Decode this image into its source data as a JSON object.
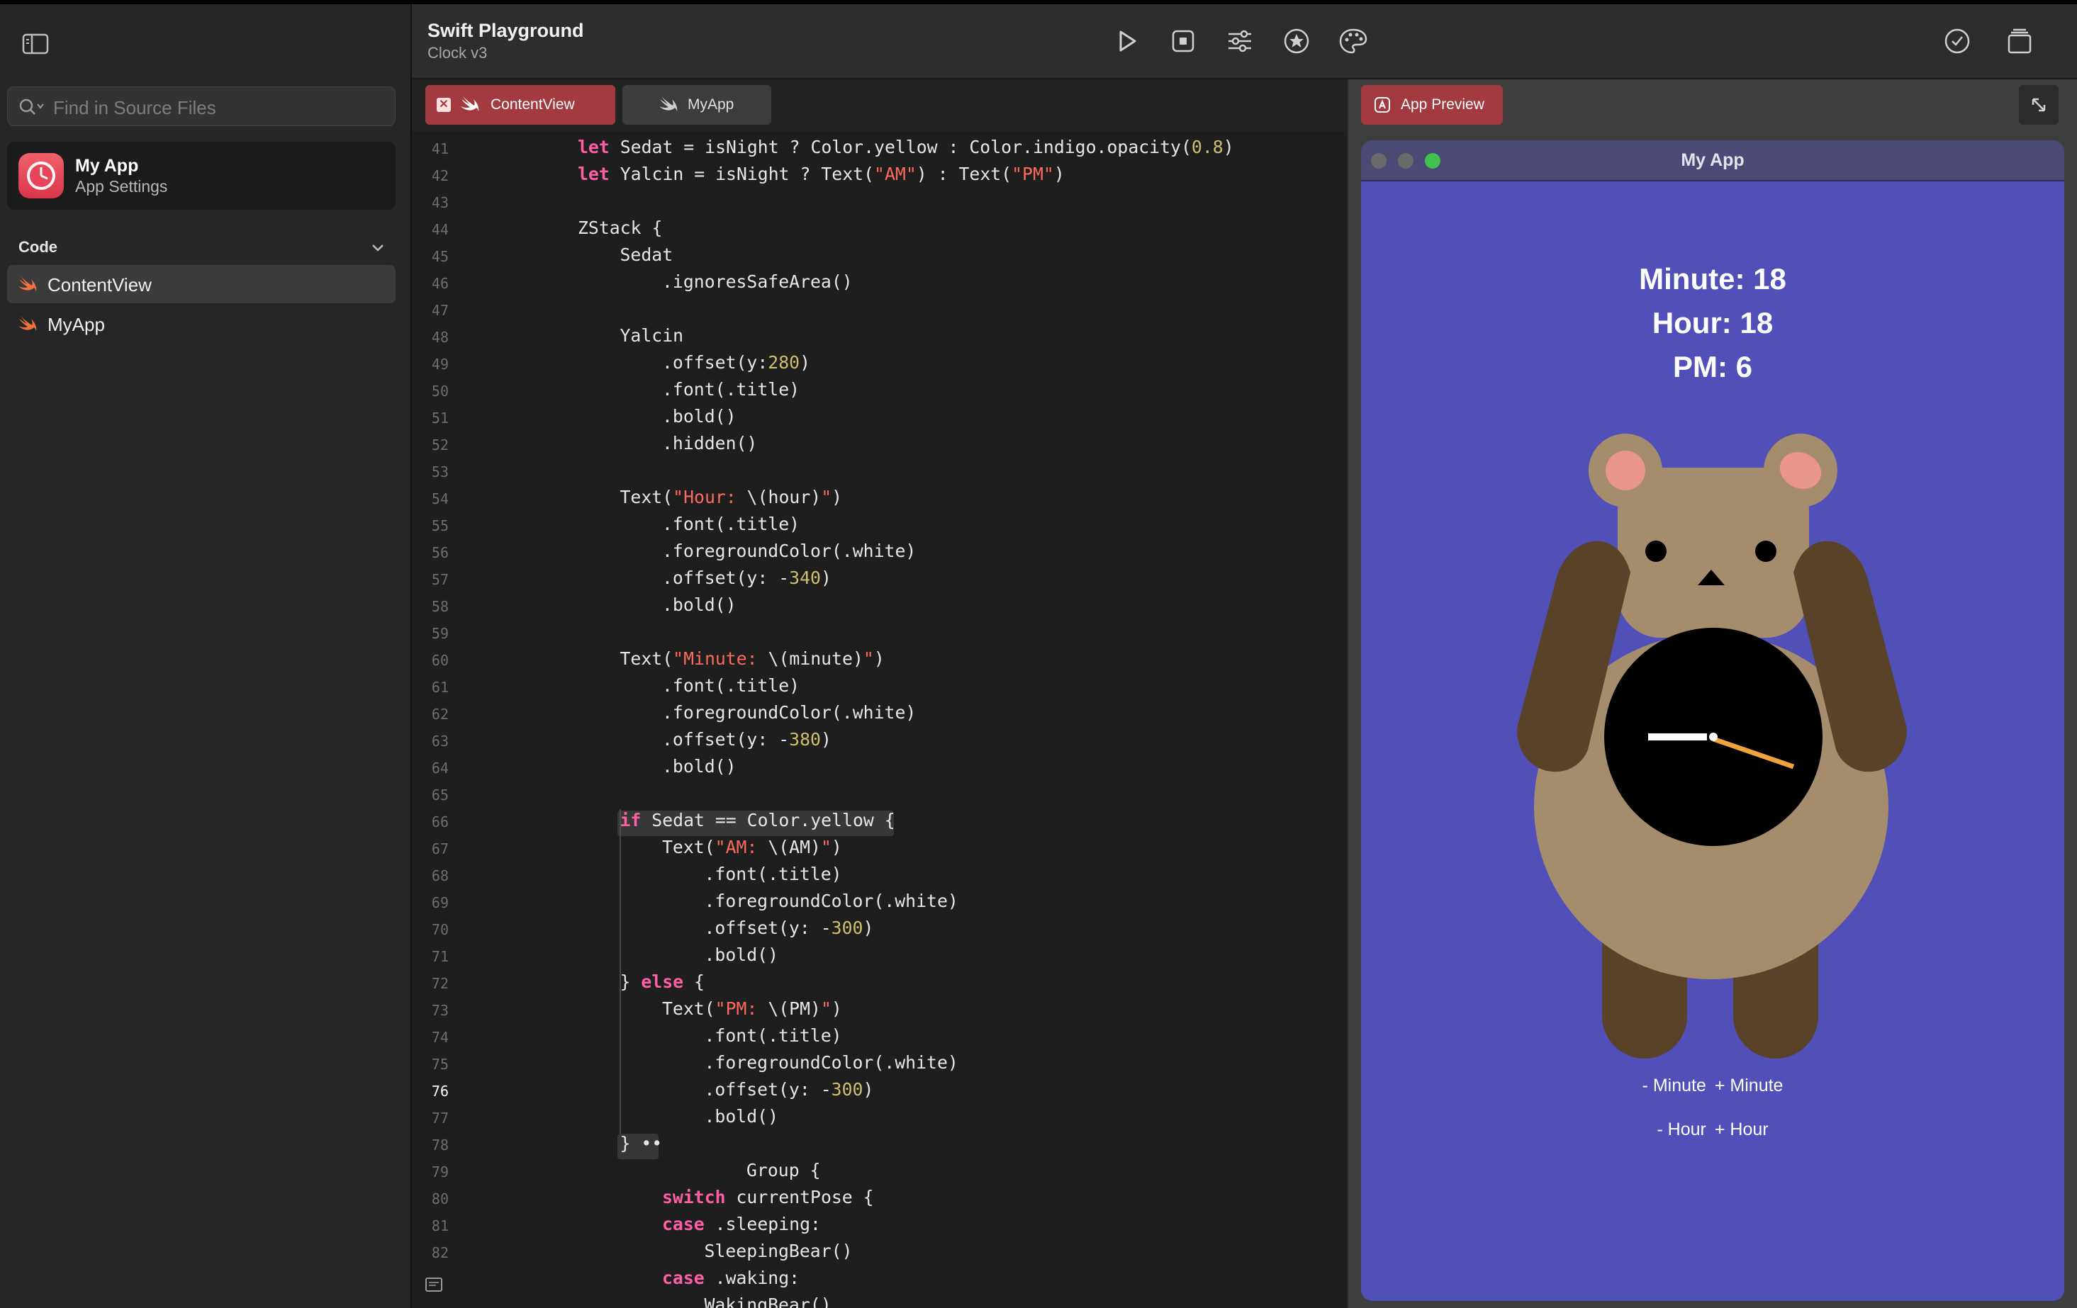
{
  "sidebar": {
    "search_placeholder": "Find in Source Files",
    "app": {
      "name": "My App",
      "subtitle": "App Settings"
    },
    "section": "Code",
    "items": [
      {
        "label": "ContentView",
        "selected": true
      },
      {
        "label": "MyApp",
        "selected": false
      }
    ]
  },
  "toolbar": {
    "title": "Swift Playground",
    "subtitle": "Clock v3",
    "buttons": [
      "play-icon",
      "stop-icon",
      "sliders-icon",
      "star-icon",
      "palette-icon",
      "checkmark-icon",
      "windows-icon"
    ]
  },
  "tabs": [
    {
      "label": "ContentView",
      "active": true
    },
    {
      "label": "MyApp",
      "active": false
    }
  ],
  "editor": {
    "current_line": 76,
    "lines": [
      {
        "n": "41",
        "indent": 2,
        "seg": [
          [
            "kw",
            "let"
          ],
          [
            "p",
            " Sedat = isNight ? Color.yellow : Color.indigo.opacity("
          ],
          [
            "num",
            "0.8"
          ],
          [
            "p",
            ")"
          ]
        ]
      },
      {
        "n": "42",
        "indent": 2,
        "seg": [
          [
            "kw",
            "let"
          ],
          [
            "p",
            " Yalcin = isNight ? Text("
          ],
          [
            "str",
            "\"AM\""
          ],
          [
            "p",
            ") : Text("
          ],
          [
            "str",
            "\"PM\""
          ],
          [
            "p",
            ")"
          ]
        ]
      },
      {
        "n": "43",
        "indent": 0,
        "seg": []
      },
      {
        "n": "44",
        "indent": 2,
        "seg": [
          [
            "p",
            "ZStack {"
          ]
        ]
      },
      {
        "n": "45",
        "indent": 3,
        "seg": [
          [
            "p",
            "Sedat"
          ]
        ]
      },
      {
        "n": "46",
        "indent": 4,
        "seg": [
          [
            "p",
            ".ignoresSafeArea()"
          ]
        ]
      },
      {
        "n": "47",
        "indent": 0,
        "seg": []
      },
      {
        "n": "48",
        "indent": 3,
        "seg": [
          [
            "p",
            "Yalcin"
          ]
        ]
      },
      {
        "n": "49",
        "indent": 4,
        "seg": [
          [
            "p",
            ".offset(y:"
          ],
          [
            "num",
            "280"
          ],
          [
            "p",
            ")"
          ]
        ]
      },
      {
        "n": "50",
        "indent": 4,
        "seg": [
          [
            "p",
            ".font(.title)"
          ]
        ]
      },
      {
        "n": "51",
        "indent": 4,
        "seg": [
          [
            "p",
            ".bold()"
          ]
        ]
      },
      {
        "n": "52",
        "indent": 4,
        "seg": [
          [
            "p",
            ".hidden()"
          ]
        ]
      },
      {
        "n": "53",
        "indent": 0,
        "seg": []
      },
      {
        "n": "54",
        "indent": 3,
        "seg": [
          [
            "p",
            "Text("
          ],
          [
            "str",
            "\"Hour: "
          ],
          [
            "p",
            "\\(hour)"
          ],
          [
            "str",
            "\""
          ],
          [
            "p",
            ")"
          ]
        ]
      },
      {
        "n": "55",
        "indent": 4,
        "seg": [
          [
            "p",
            ".font(.title)"
          ]
        ]
      },
      {
        "n": "56",
        "indent": 4,
        "seg": [
          [
            "p",
            ".foregroundColor(.white)"
          ]
        ]
      },
      {
        "n": "57",
        "indent": 4,
        "seg": [
          [
            "p",
            ".offset(y: -"
          ],
          [
            "num",
            "340"
          ],
          [
            "p",
            ")"
          ]
        ]
      },
      {
        "n": "58",
        "indent": 4,
        "seg": [
          [
            "p",
            ".bold()"
          ]
        ]
      },
      {
        "n": "59",
        "indent": 0,
        "seg": []
      },
      {
        "n": "60",
        "indent": 3,
        "seg": [
          [
            "p",
            "Text("
          ],
          [
            "str",
            "\"Minute: "
          ],
          [
            "p",
            "\\(minute)"
          ],
          [
            "str",
            "\""
          ],
          [
            "p",
            ")"
          ]
        ]
      },
      {
        "n": "61",
        "indent": 4,
        "seg": [
          [
            "p",
            ".font(.title)"
          ]
        ]
      },
      {
        "n": "62",
        "indent": 4,
        "seg": [
          [
            "p",
            ".foregroundColor(.white)"
          ]
        ]
      },
      {
        "n": "63",
        "indent": 4,
        "seg": [
          [
            "p",
            ".offset(y: -"
          ],
          [
            "num",
            "380"
          ],
          [
            "p",
            ")"
          ]
        ]
      },
      {
        "n": "64",
        "indent": 4,
        "seg": [
          [
            "p",
            ".bold()"
          ]
        ]
      },
      {
        "n": "65",
        "indent": 0,
        "seg": []
      },
      {
        "n": "66",
        "indent": 3,
        "seg": [
          [
            "kw",
            "if"
          ],
          [
            "p",
            " Sedat == Color.yellow {"
          ]
        ]
      },
      {
        "n": "67",
        "indent": 4,
        "seg": [
          [
            "p",
            "Text("
          ],
          [
            "str",
            "\"AM: "
          ],
          [
            "p",
            "\\(AM)"
          ],
          [
            "str",
            "\""
          ],
          [
            "p",
            ")"
          ]
        ]
      },
      {
        "n": "68",
        "indent": 5,
        "seg": [
          [
            "p",
            ".font(.title)"
          ]
        ]
      },
      {
        "n": "69",
        "indent": 5,
        "seg": [
          [
            "p",
            ".foregroundColor(.white)"
          ]
        ]
      },
      {
        "n": "70",
        "indent": 5,
        "seg": [
          [
            "p",
            ".offset(y: -"
          ],
          [
            "num",
            "300"
          ],
          [
            "p",
            ")"
          ]
        ]
      },
      {
        "n": "71",
        "indent": 5,
        "seg": [
          [
            "p",
            ".bold()"
          ]
        ]
      },
      {
        "n": "72",
        "indent": 3,
        "seg": [
          [
            "p",
            "} "
          ],
          [
            "kw",
            "else"
          ],
          [
            "p",
            " {"
          ]
        ]
      },
      {
        "n": "73",
        "indent": 4,
        "seg": [
          [
            "p",
            "Text("
          ],
          [
            "str",
            "\"PM: "
          ],
          [
            "p",
            "\\(PM)"
          ],
          [
            "str",
            "\""
          ],
          [
            "p",
            ")"
          ]
        ]
      },
      {
        "n": "74",
        "indent": 5,
        "seg": [
          [
            "p",
            ".font(.title)"
          ]
        ]
      },
      {
        "n": "75",
        "indent": 5,
        "seg": [
          [
            "p",
            ".foregroundColor(.white)"
          ]
        ]
      },
      {
        "n": "76",
        "indent": 5,
        "seg": [
          [
            "p",
            ".offset(y: -"
          ],
          [
            "num",
            "300"
          ],
          [
            "p",
            ")"
          ]
        ]
      },
      {
        "n": "77",
        "indent": 5,
        "seg": [
          [
            "p",
            ".bold()"
          ]
        ]
      },
      {
        "n": "78",
        "indent": 3,
        "seg": [
          [
            "p",
            "} ••"
          ]
        ]
      },
      {
        "n": "79",
        "indent": 6,
        "seg": [
          [
            "p",
            "Group {"
          ]
        ]
      },
      {
        "n": "80",
        "indent": 4,
        "seg": [
          [
            "kw",
            "switch"
          ],
          [
            "p",
            " currentPose {"
          ]
        ]
      },
      {
        "n": "81",
        "indent": 4,
        "seg": [
          [
            "kw",
            "case"
          ],
          [
            "p",
            " .sleeping:"
          ]
        ]
      },
      {
        "n": "82",
        "indent": 5,
        "seg": [
          [
            "p",
            "SleepingBear()"
          ]
        ]
      },
      {
        "n": "",
        "indent": 4,
        "seg": [
          [
            "kw",
            "case"
          ],
          [
            "p",
            " .waking:"
          ]
        ]
      },
      {
        "n": "",
        "indent": 5,
        "seg": [
          [
            "p",
            "WakingBear()"
          ]
        ]
      }
    ]
  },
  "preview": {
    "tab_label": "App Preview",
    "window_title": "My App",
    "minute_text": "Minute: 18",
    "hour_text": "Hour: 18",
    "pm_text": "PM: 6",
    "minus_minute": "- Minute",
    "plus_minute": "+ Minute",
    "minus_hour": "- Hour",
    "plus_hour": "+ Hour",
    "colors": {
      "background": "#5050b8",
      "bear": "#a58c6c",
      "arms": "#5a4228",
      "ears": "#e8958a",
      "hand_minute": "#f0a23c"
    }
  }
}
